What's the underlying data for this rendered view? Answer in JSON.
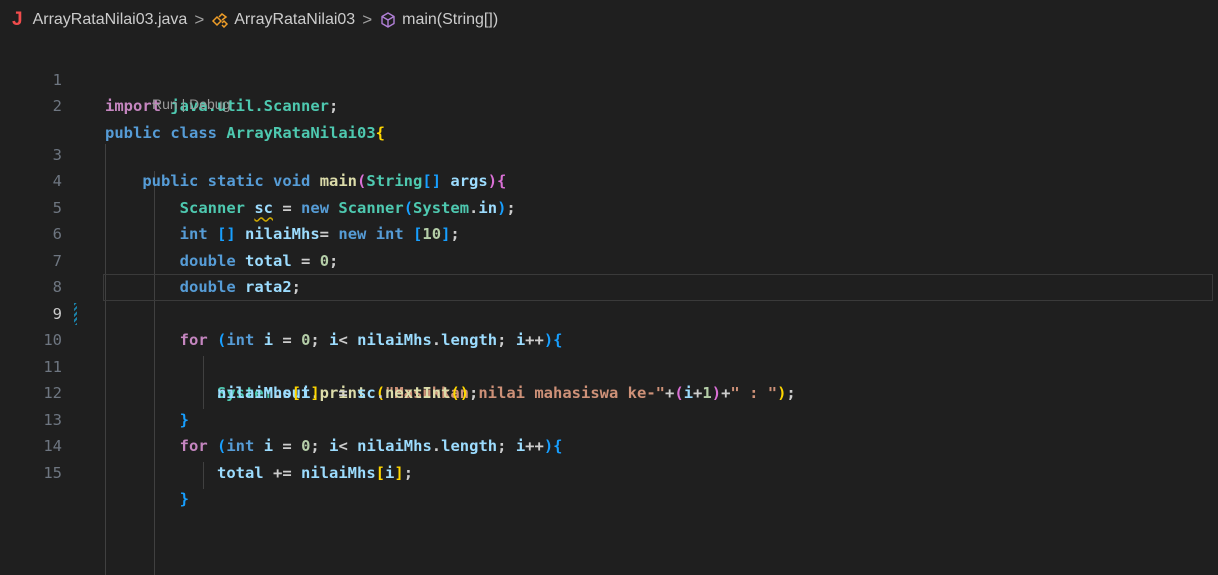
{
  "breadcrumb": {
    "file_icon_glyph": "J",
    "file": "ArrayRataNilai03.java",
    "class_name": "ArrayRataNilai03",
    "method": "main(String[])",
    "separator": ">"
  },
  "codelens": {
    "run": "Run",
    "sep": " | ",
    "debug": "Debug"
  },
  "line_numbers": [
    "1",
    "2",
    "3",
    "4",
    "5",
    "6",
    "7",
    "8",
    "9",
    "10",
    "11",
    "12",
    "13",
    "14",
    "15"
  ],
  "current_line": "9",
  "tokens": {
    "import": "import",
    "java_util_scanner": "java.util.Scanner",
    "public": "public",
    "class": "class",
    "class_name": "ArrayRataNilai03",
    "static": "static",
    "void": "void",
    "main": "main",
    "string_type": "String",
    "args": "args",
    "scanner_type": "Scanner",
    "sc": "sc",
    "new": "new",
    "system": "System",
    "in": "in",
    "int": "int",
    "nilaiMhs": "nilaiMhs",
    "ten": "10",
    "double": "double",
    "total": "total",
    "zero": "0",
    "rata2": "rata2",
    "for": "for",
    "i": "i",
    "length": "length",
    "out": "out",
    "print": "print",
    "prompt_string": "\"Masukkan nilai mahasiswa ke-\"",
    "one": "1",
    "colon_string": "\" : \"",
    "nextInt": "nextInt"
  }
}
